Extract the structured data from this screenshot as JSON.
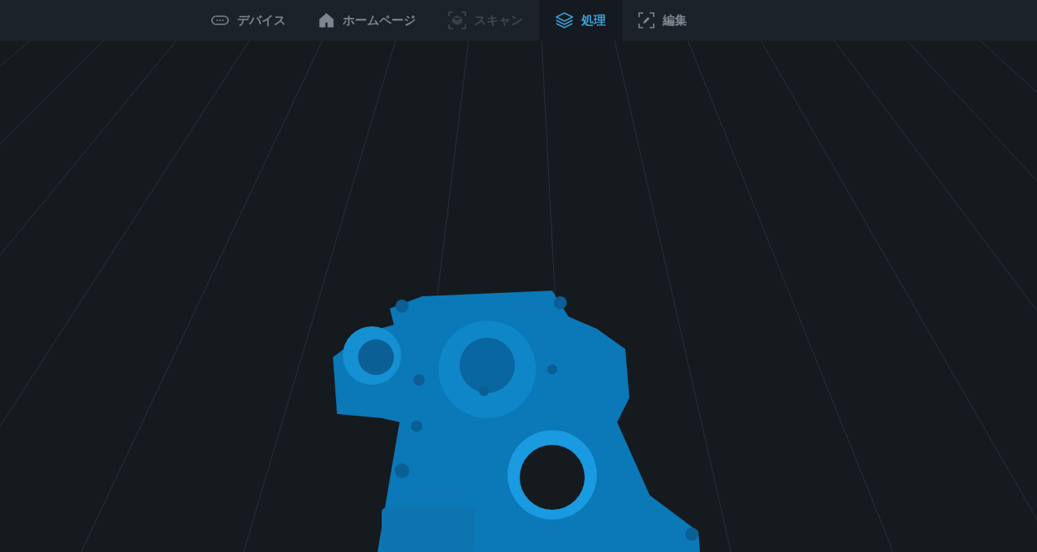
{
  "tabs": [
    {
      "label": "デバイス",
      "kind": "device",
      "selected": false,
      "disabled": false
    },
    {
      "label": "ホームページ",
      "kind": "home",
      "selected": false,
      "disabled": false
    },
    {
      "label": "スキャン",
      "kind": "scan",
      "selected": false,
      "disabled": true
    },
    {
      "label": "処理",
      "kind": "layers",
      "selected": true,
      "disabled": false
    },
    {
      "label": "編集",
      "kind": "edit",
      "selected": false,
      "disabled": false
    }
  ]
}
